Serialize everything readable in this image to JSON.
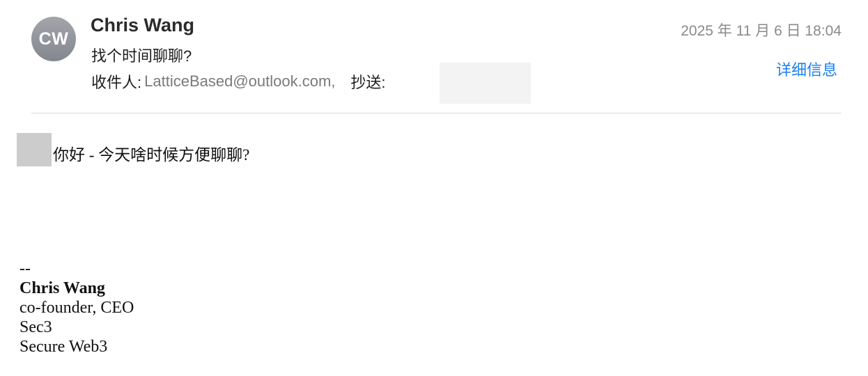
{
  "header": {
    "avatar_initials": "CW",
    "sender_name": "Chris Wang",
    "subject": "找个时间聊聊?",
    "to_label": "收件人:",
    "to_address": "LatticeBased@outlook.com,",
    "cc_label": "抄送:",
    "date": "2025 年 11 月 6 日 18:04",
    "details_link": "详细信息"
  },
  "body": {
    "greeting": "你好 - 今天啥时候方便聊聊?"
  },
  "signature": {
    "separator": "--",
    "name": "Chris Wang",
    "title": "co-founder, CEO",
    "company": "Sec3",
    "tagline": "Secure Web3"
  },
  "colors": {
    "link": "#1a7ff0",
    "muted_text": "#8a8a8a",
    "avatar_bg": "#94969c",
    "redaction": "#cccccc"
  }
}
